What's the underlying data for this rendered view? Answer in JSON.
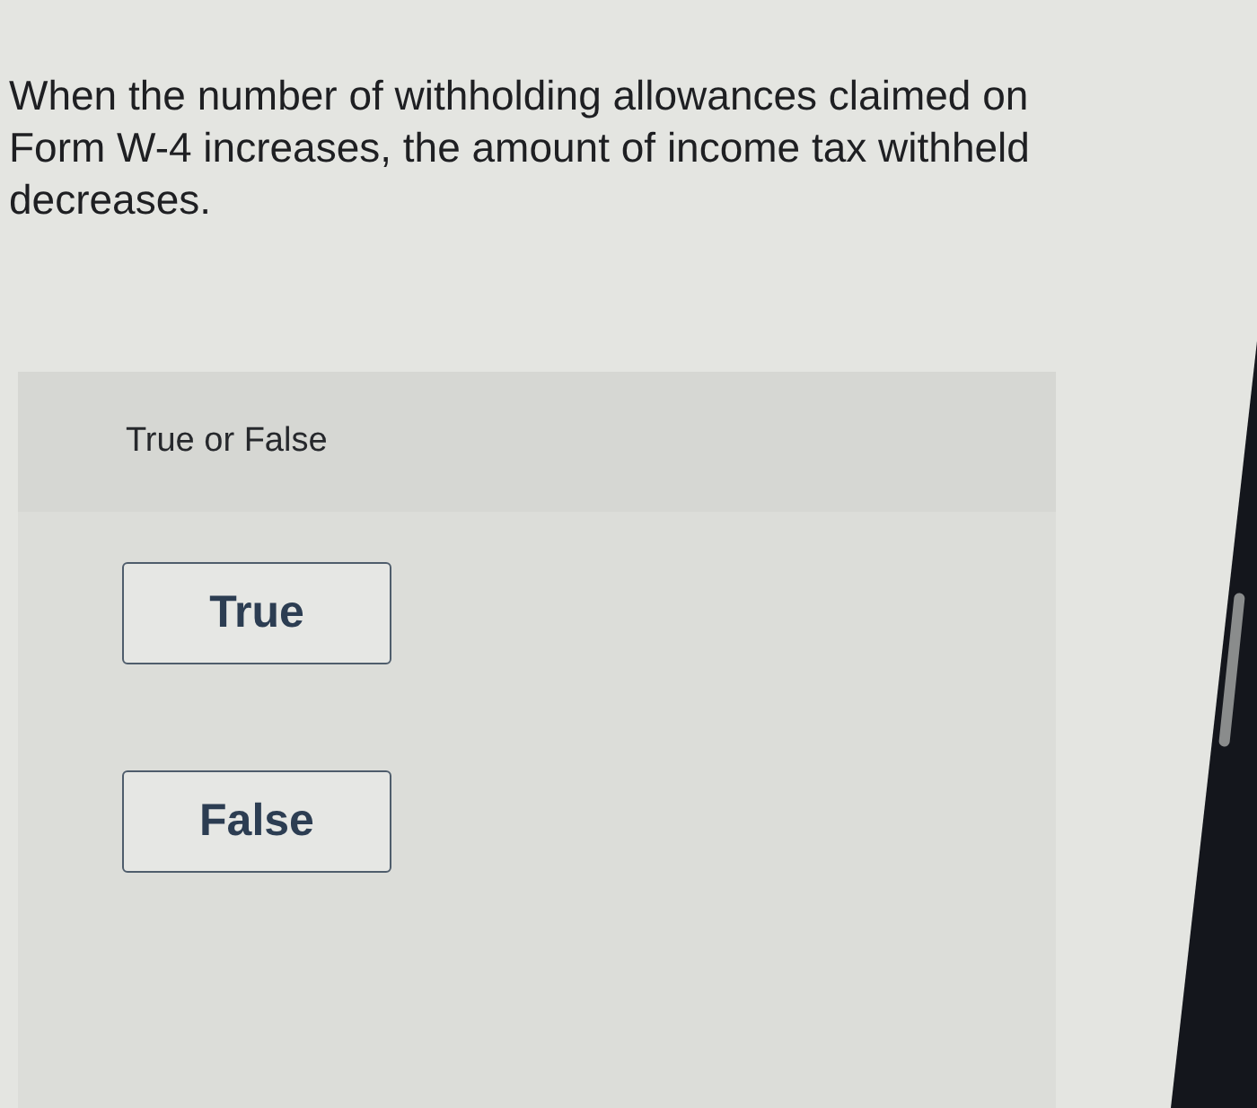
{
  "question": {
    "text": "When the number of withholding allowances claimed on Form W-4 increases, the amount of income tax withheld decreases."
  },
  "answer_panel": {
    "prompt": "True or False",
    "options": [
      {
        "label": "True",
        "selected": false
      },
      {
        "label": "False",
        "selected": false
      }
    ]
  }
}
